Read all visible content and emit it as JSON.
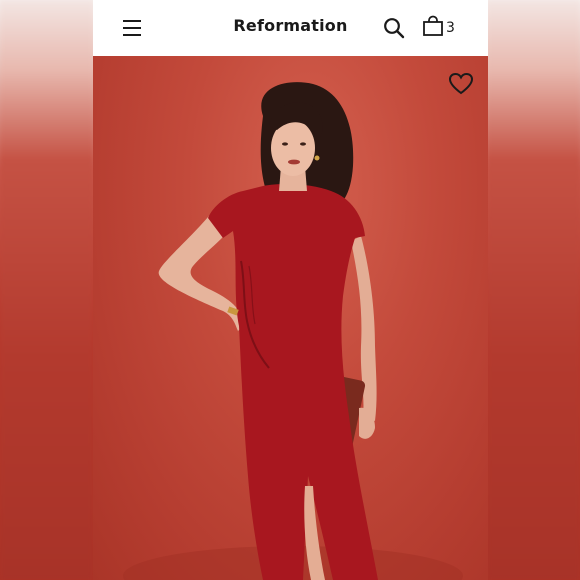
{
  "header": {
    "brand": "Reformation",
    "cart_count": "3",
    "icons": {
      "menu": "hamburger-menu-icon",
      "search": "search-icon",
      "cart": "shopping-bag-icon"
    }
  },
  "hero": {
    "image": "product-photo-red-midi-dress",
    "wishlist_icon": "heart-outline-icon",
    "colors": {
      "background": "#c34a3b",
      "dress": "#a8171f"
    }
  }
}
